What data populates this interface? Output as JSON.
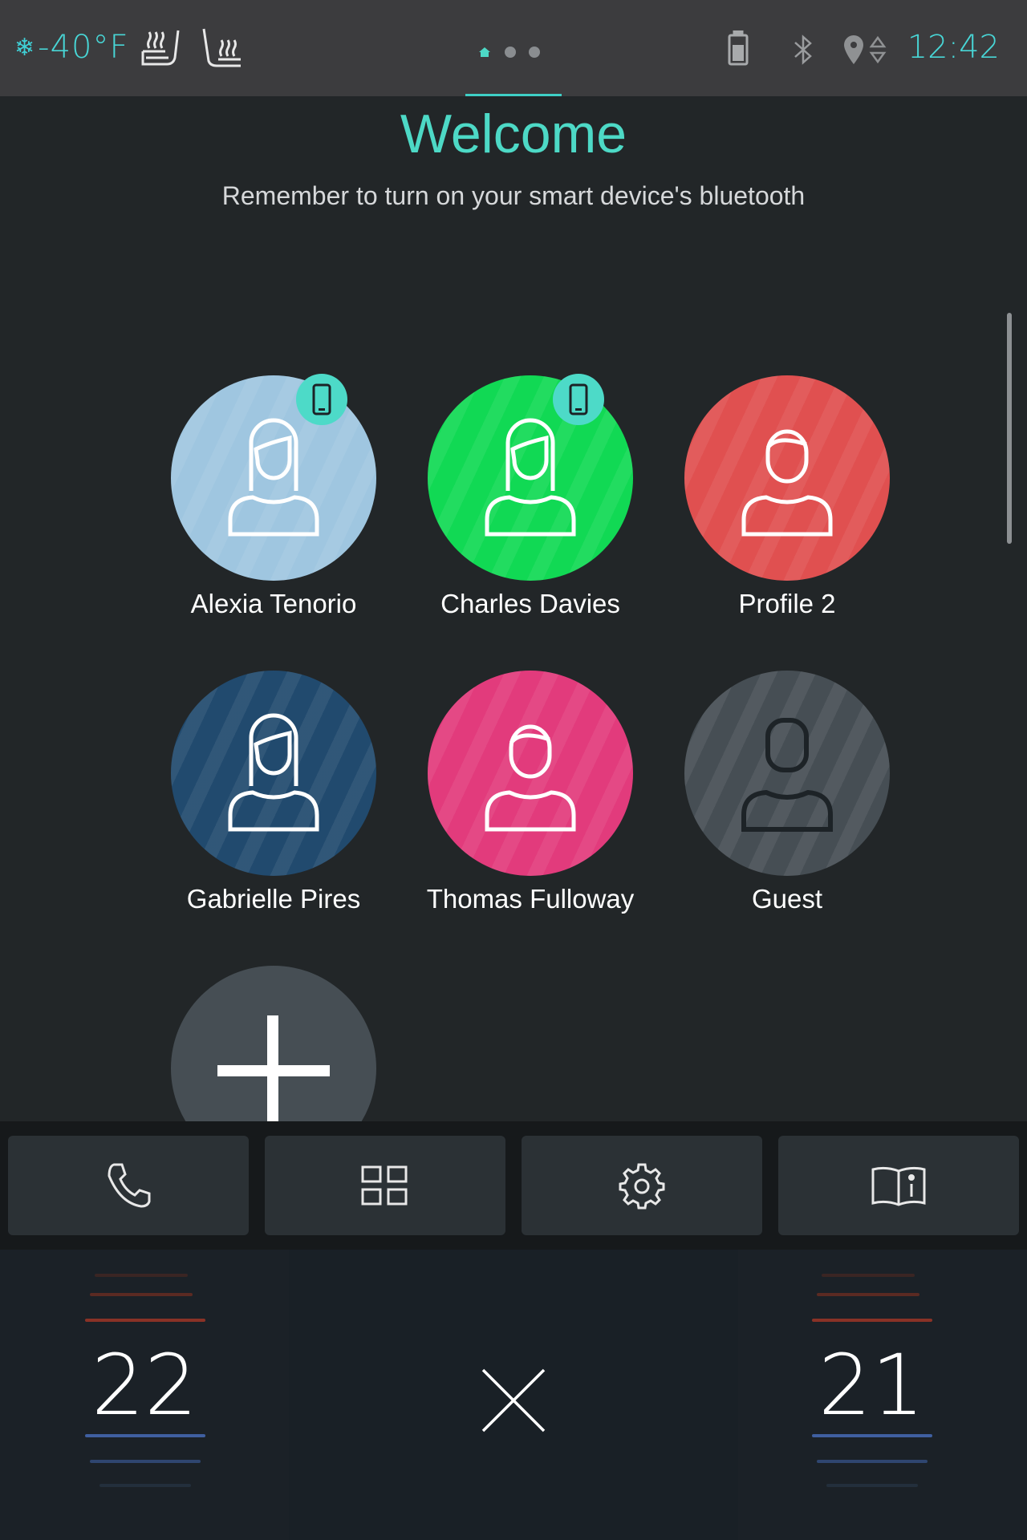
{
  "status_bar": {
    "outside_temp": "-40°F",
    "clock": "12:42",
    "icons": [
      "snowflake-icon",
      "heated-seat-icon",
      "heated-seat-rear-icon",
      "home-icon",
      "battery-icon",
      "bluetooth-icon",
      "location-icon"
    ]
  },
  "header": {
    "title": "Welcome",
    "subtitle": "Remember to turn on your smart device's bluetooth"
  },
  "profiles": [
    {
      "name": "Alexia Tenorio",
      "color": "#9fc6e0",
      "phone_paired": true
    },
    {
      "name": "Charles Davies",
      "color": "#11d954",
      "phone_paired": true
    },
    {
      "name": "Profile 2",
      "color": "#e05050",
      "phone_paired": false
    },
    {
      "name": "Gabrielle Pires",
      "color": "#214a6e",
      "phone_paired": false
    },
    {
      "name": "Thomas Fulloway",
      "color": "#e23b7c",
      "phone_paired": false
    },
    {
      "name": "Guest",
      "color": "#464e54",
      "phone_paired": false
    }
  ],
  "add_profile": {
    "icon": "plus-icon",
    "color": "#464e54"
  },
  "dock": {
    "buttons": [
      "phone-icon",
      "apps-grid-icon",
      "settings-gear-icon",
      "manual-book-icon"
    ]
  },
  "climate": {
    "left_temp": "22",
    "right_temp": "21",
    "center_icon": "close-icon",
    "heat_color": "#8a3226",
    "cool_color": "#3f5fa0"
  },
  "colors": {
    "accent": "#4dd9c6",
    "background": "#222628"
  }
}
